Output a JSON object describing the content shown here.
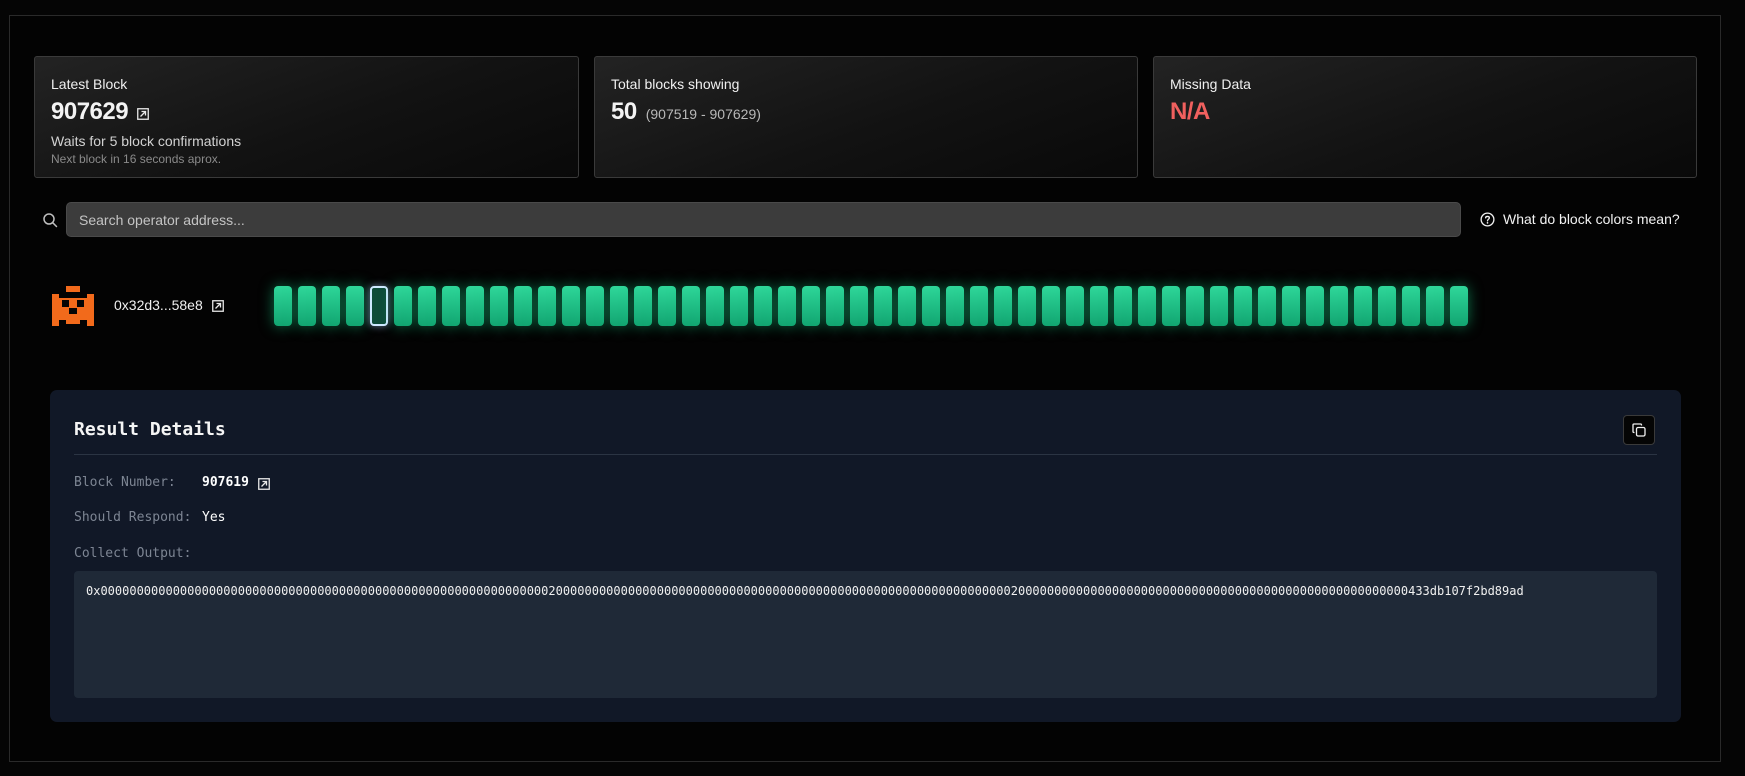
{
  "colors": {
    "accent_green": "#1ec58a",
    "missing_red": "#f0605e",
    "avatar_orange": "#f26a1b",
    "panel_bg": "#111827"
  },
  "stats": {
    "latest": {
      "title": "Latest Block",
      "value": "907629",
      "note": "Waits for 5 block confirmations",
      "sub": "Next block in 16 seconds aprox."
    },
    "total": {
      "title": "Total blocks showing",
      "value": "50",
      "range": "(907519 - 907629)"
    },
    "missing": {
      "title": "Missing Data",
      "value": "N/A"
    }
  },
  "search": {
    "placeholder": "Search operator address..."
  },
  "help": {
    "label": "What do block colors mean?"
  },
  "operator": {
    "address": "0x32d3...58e8",
    "icon": "pixel-avatar-icon"
  },
  "blocks": {
    "count": 50,
    "selected_index": 4,
    "status": "success"
  },
  "details": {
    "title": "Result Details",
    "block_number_label": "Block Number:",
    "block_number": "907619",
    "should_respond_label": "Should Respond:",
    "should_respond": "Yes",
    "collect_output_label": "Collect Output:",
    "collect_output": "0x0000000000000000000000000000000000000000000000000000000000000020000000000000000000000000000000000000000000000000000000000000002000000000000000000000000000000000000000000000000000000433db107f2bd89ad"
  }
}
